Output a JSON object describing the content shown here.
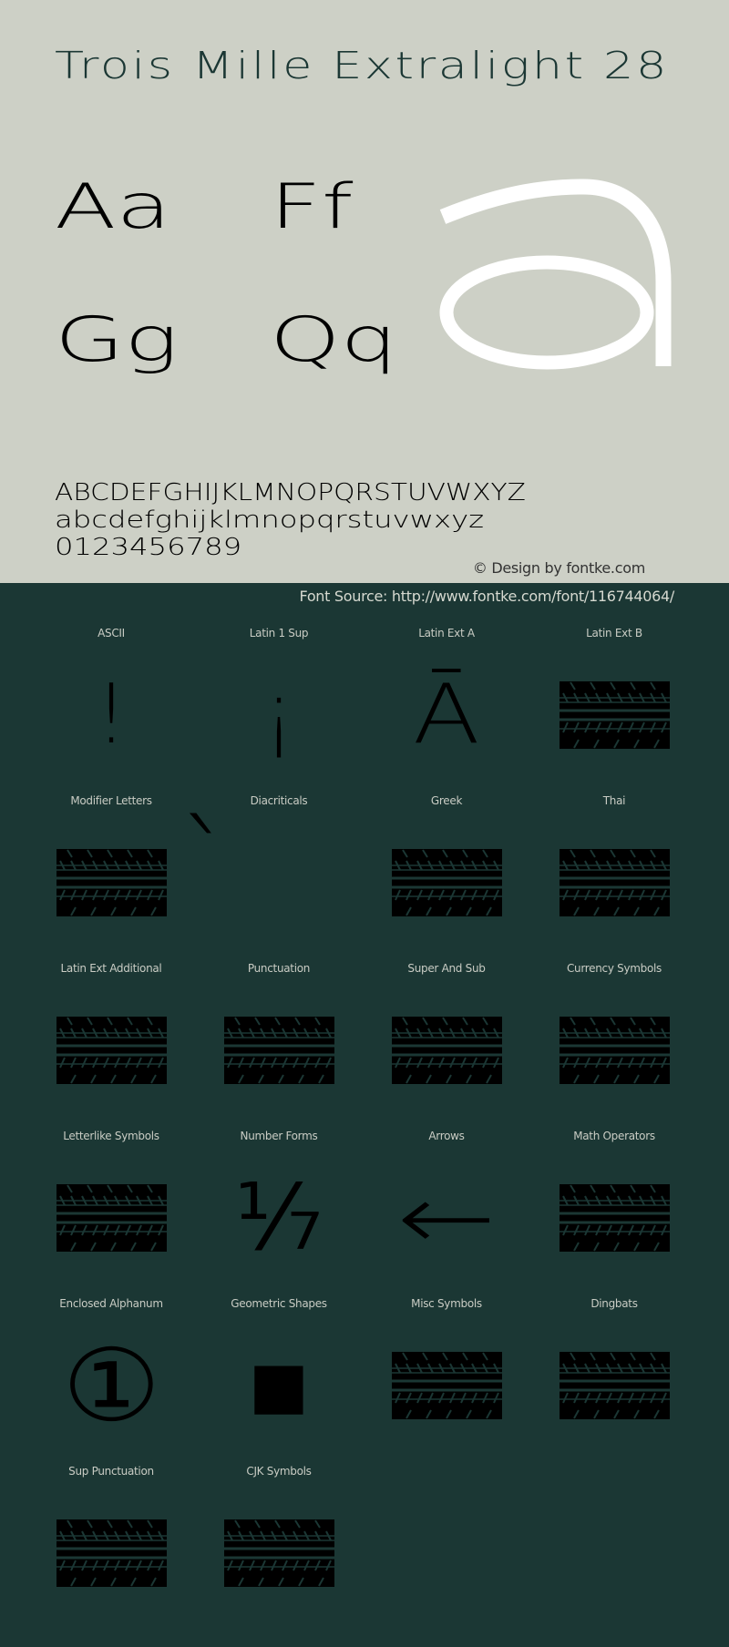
{
  "header": {
    "title": "Trois Mille Extralight 28",
    "pairs": [
      "Aa",
      "Ff",
      "Gg",
      "Qq"
    ],
    "hero_glyph": "a",
    "uppercase": "ABCDEFGHIJKLMNOPQRSTUVWXYZ",
    "lowercase": "abcdefghijklmnopqrstuvwxyz",
    "digits": "0123456789",
    "credit": "© Design by fontke.com",
    "source": "Font Source: http://www.fontke.com/font/116744064/"
  },
  "colors": {
    "light_bg": "#cdd0c6",
    "dark_bg": "#1b3734",
    "hero_glyph": "#ffffff",
    "glyph": "#000000"
  },
  "blocks": [
    {
      "label": "ASCII",
      "glyph": "!",
      "missing": false
    },
    {
      "label": "Latin 1 Sup",
      "glyph": "¡",
      "missing": false
    },
    {
      "label": "Latin Ext A",
      "glyph": "Ā",
      "missing": false
    },
    {
      "label": "Latin Ext B",
      "glyph": "",
      "missing": true
    },
    {
      "label": "Modifier Letters",
      "glyph": "",
      "missing": true
    },
    {
      "label": "Diacriticals",
      "glyph": "̀",
      "missing": false
    },
    {
      "label": "Greek",
      "glyph": "",
      "missing": true
    },
    {
      "label": "Thai",
      "glyph": "",
      "missing": true
    },
    {
      "label": "Latin Ext Additional",
      "glyph": "",
      "missing": true
    },
    {
      "label": "Punctuation",
      "glyph": "",
      "missing": true
    },
    {
      "label": "Super And Sub",
      "glyph": "",
      "missing": true
    },
    {
      "label": "Currency Symbols",
      "glyph": "",
      "missing": true
    },
    {
      "label": "Letterlike Symbols",
      "glyph": "",
      "missing": true
    },
    {
      "label": "Number Forms",
      "glyph": "⅐",
      "missing": false
    },
    {
      "label": "Arrows",
      "glyph": "←",
      "missing": false
    },
    {
      "label": "Math Operators",
      "glyph": "",
      "missing": true
    },
    {
      "label": "Enclosed Alphanum",
      "glyph": "①",
      "missing": false
    },
    {
      "label": "Geometric Shapes",
      "glyph": "■",
      "missing": false
    },
    {
      "label": "Misc Symbols",
      "glyph": "",
      "missing": true
    },
    {
      "label": "Dingbats",
      "glyph": "",
      "missing": true
    },
    {
      "label": "Sup Punctuation",
      "glyph": "",
      "missing": true
    },
    {
      "label": "CJK Symbols",
      "glyph": "",
      "missing": true
    }
  ]
}
